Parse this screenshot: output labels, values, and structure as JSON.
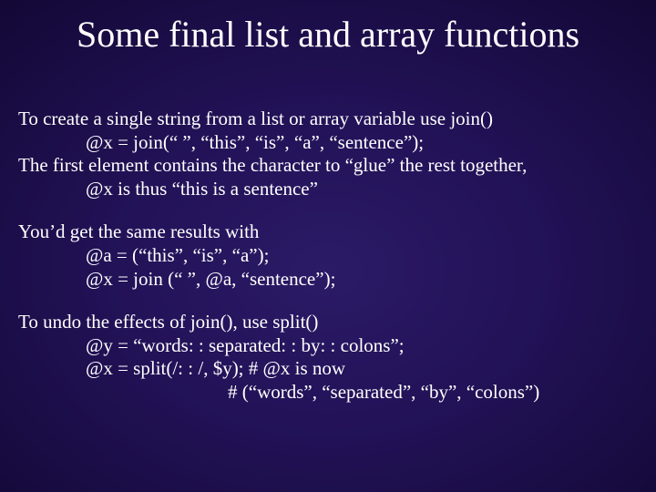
{
  "title": "Some final list and array functions",
  "b1": {
    "l1": "To create a single string from a list or array variable use join()",
    "l2": "@x = join(“ ”, “this”, “is”, “a”, “sentence”);",
    "l3": "The first element contains the character to “glue” the rest together,",
    "l4": "@x is thus “this is a sentence”"
  },
  "b2": {
    "l1": "You’d get the same results with",
    "l2": "@a = (“this”, “is”, “a”);",
    "l3": "@x = join (“ ”, @a, “sentence”);"
  },
  "b3": {
    "l1": "To undo the effects of join(), use split()",
    "l2": "@y = “words: : separated: : by: : colons”;",
    "l3": "@x = split(/: : /, $y); # @x is now",
    "l4": "# (“words”, “separated”, “by”, “colons”)"
  }
}
